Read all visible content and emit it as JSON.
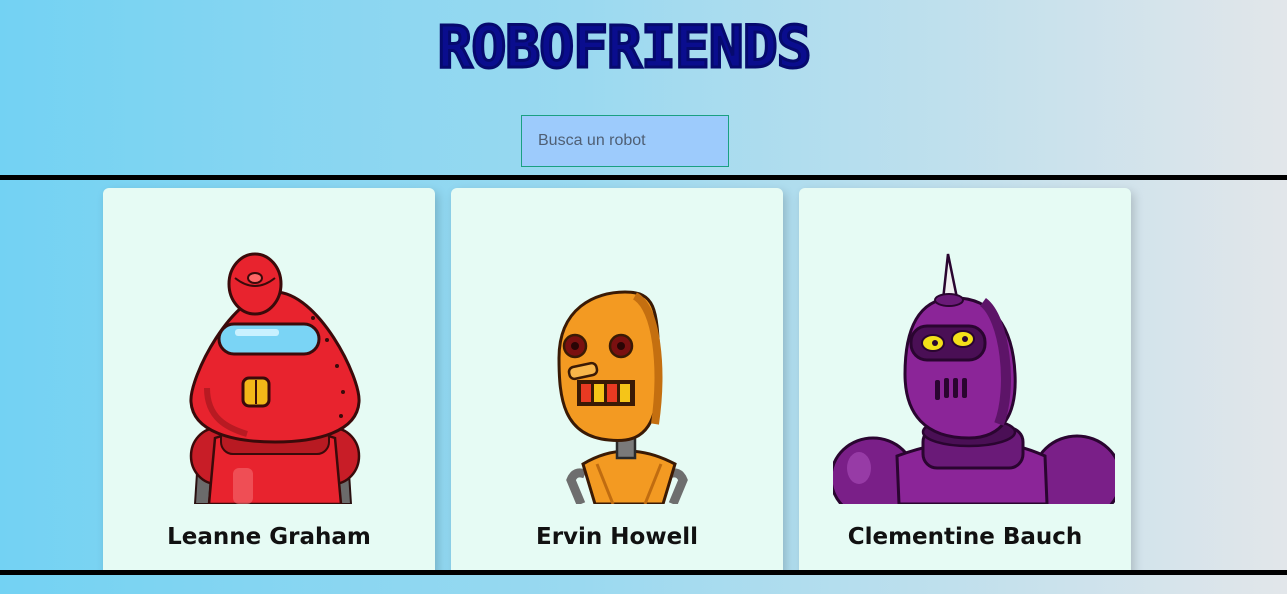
{
  "header": {
    "title": "ROBOFRIENDS"
  },
  "search": {
    "placeholder": "Busca un robot",
    "value": "",
    "background_color": "#9dcbfc",
    "border_color": "#1aa082"
  },
  "colors": {
    "title": "#0a0d8e",
    "card_background": "#e6fbf4",
    "frame_border": "#000000"
  },
  "robots": [
    {
      "name": "Leanne Graham",
      "image_icon": "red-robot-icon",
      "color": "#e8232e"
    },
    {
      "name": "Ervin Howell",
      "image_icon": "orange-robot-icon",
      "color": "#f39a22"
    },
    {
      "name": "Clementine Bauch",
      "image_icon": "purple-robot-icon",
      "color": "#8b2598"
    }
  ]
}
